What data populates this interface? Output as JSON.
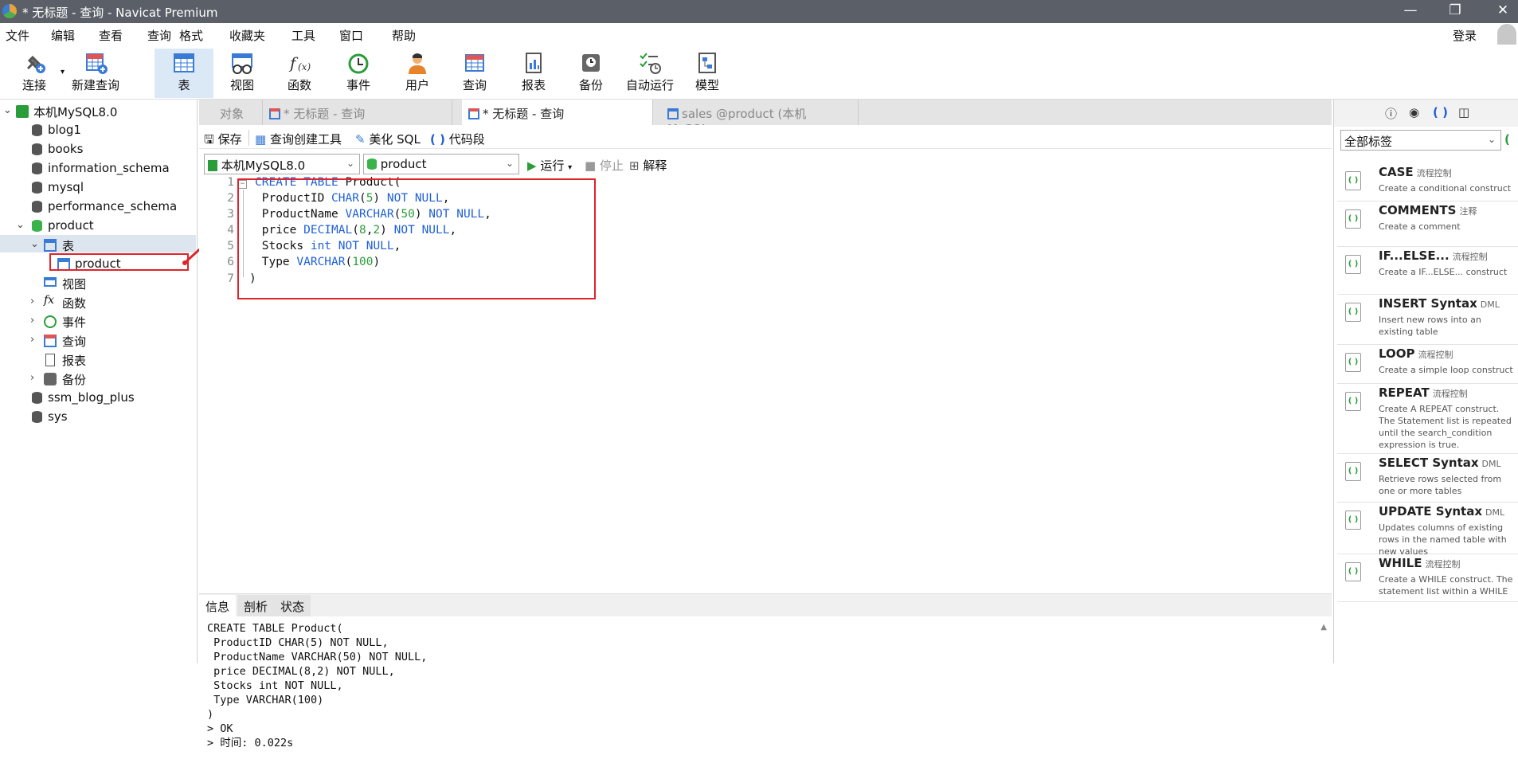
{
  "window": {
    "title": "* 无标题 - 查询 - Navicat Premium",
    "min": "—",
    "max": "❐",
    "close": "✕"
  },
  "menu": {
    "items": [
      "文件",
      "编辑",
      "查看",
      "查询",
      "格式",
      "收藏夹",
      "工具",
      "窗口",
      "帮助"
    ],
    "login": "登录"
  },
  "toolbar": {
    "buttons": [
      "连接",
      "新建查询",
      "表",
      "视图",
      "函数",
      "事件",
      "用户",
      "查询",
      "报表",
      "备份",
      "自动运行",
      "模型"
    ],
    "active": "表"
  },
  "tree": {
    "connection": "本机MySQL8.0",
    "databases": [
      "blog1",
      "books",
      "information_schema",
      "mysql",
      "performance_schema",
      "product",
      "ssm_blog_plus",
      "sys"
    ],
    "product_children": {
      "tables": "表",
      "table_item": "product",
      "views": "视图",
      "functions": "函数",
      "events": "事件",
      "queries": "查询",
      "reports": "报表",
      "backups": "备份"
    }
  },
  "tabs": [
    "对象",
    "* 无标题 - 查询",
    "* 无标题 - 查询",
    "sales @product (本机MySQL..."
  ],
  "subbar": {
    "save": "保存",
    "builder": "查询创建工具",
    "beautify": "美化 SQL",
    "snippet": "代码段"
  },
  "selectbar": {
    "connection": "本机MySQL8.0",
    "database": "product",
    "run": "运行",
    "stop": "停止",
    "explain": "解释"
  },
  "editor": {
    "line_numbers": [
      "1",
      "2",
      "3",
      "4",
      "5",
      "6",
      "7"
    ]
  },
  "bottom": {
    "tabs": [
      "信息",
      "剖析",
      "状态"
    ],
    "output": [
      "CREATE TABLE Product(",
      "ProductID CHAR(5) NOT NULL,",
      "ProductName VARCHAR(50) NOT NULL,",
      "price DECIMAL(8,2) NOT NULL,",
      "Stocks int NOT NULL,",
      "Type VARCHAR(100)",
      ")",
      "> OK",
      "> 时间: 0.022s"
    ]
  },
  "right": {
    "tag_select": "全部标签",
    "snippets": [
      {
        "name": "CASE",
        "tag": "流程控制",
        "desc": "Create a conditional construct"
      },
      {
        "name": "COMMENTS",
        "tag": "注释",
        "desc": "Create a comment"
      },
      {
        "name": "IF...ELSE...",
        "tag": "流程控制",
        "desc": "Create a IF...ELSE... construct"
      },
      {
        "name": "INSERT Syntax",
        "tag": "DML",
        "desc": "Insert new rows into an existing table"
      },
      {
        "name": "LOOP",
        "tag": "流程控制",
        "desc": "Create a simple loop construct"
      },
      {
        "name": "REPEAT",
        "tag": "流程控制",
        "desc": "Create A REPEAT construct. The Statement list is repeated until the search_condition expression is true."
      },
      {
        "name": "SELECT Syntax",
        "tag": "DML",
        "desc": "Retrieve rows selected from one or more tables"
      },
      {
        "name": "UPDATE Syntax",
        "tag": "DML",
        "desc": "Updates columns of existing rows in the named table with new values"
      },
      {
        "name": "WHILE",
        "tag": "流程控制",
        "desc": "Create a WHILE construct. The statement list within a WHILE"
      }
    ]
  },
  "colors": {
    "keyword": "#1f5fd6",
    "number": "#2a9d3a",
    "highlight": "#e0232a",
    "active_tool": "#dbe8f6"
  }
}
